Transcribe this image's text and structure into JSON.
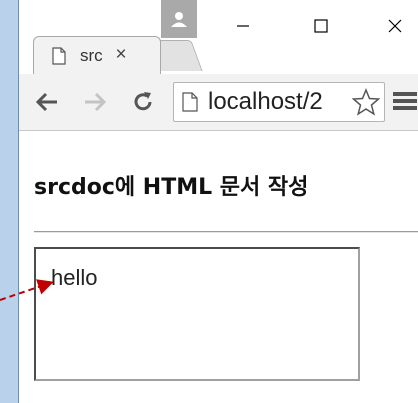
{
  "browser": {
    "tab": {
      "title": "src",
      "close_symbol": "×"
    },
    "window_controls": {
      "minimize": "—",
      "maximize": "☐",
      "close": "✕"
    },
    "toolbar": {
      "back_icon": "arrow-left-icon",
      "forward_icon": "arrow-right-icon",
      "reload_icon": "reload-icon",
      "address": "localhost/2",
      "bookmark_icon": "star-icon",
      "menu_icon": "hamburger-icon"
    }
  },
  "page": {
    "heading": "srcdoc에 HTML 문서 작성",
    "iframe": {
      "text": "hello"
    }
  },
  "colors": {
    "arrow": "#c00000",
    "window_border": "#6c8fb5",
    "desktop": "#b9d1ea"
  }
}
